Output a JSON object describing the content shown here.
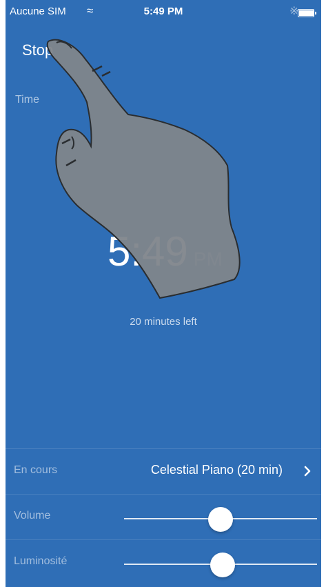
{
  "status_bar": {
    "carrier": "Aucune SIM",
    "time": "5:49 PM",
    "wifi_icon": "wifi-icon",
    "bluetooth_icon": "bluetooth-icon",
    "battery_icon": "battery-icon",
    "battery_level": 1.0
  },
  "header": {
    "stop_label": "Stop"
  },
  "main": {
    "time_label": "Time",
    "clock": "5:49",
    "ampm": "PM",
    "remaining": "20 minutes left"
  },
  "settings": {
    "playing_label": "En cours",
    "playing_value": "Celestial Piano (20 min)",
    "volume_label": "Volume",
    "volume_level": 0.5,
    "brightness_label": "Luminosité",
    "brightness_level": 0.51
  },
  "overlay": {
    "icon": "pointing-hand-icon"
  },
  "colors": {
    "background": "#2f6eb6",
    "text": "#ffffff",
    "hand": "#7f858b"
  }
}
